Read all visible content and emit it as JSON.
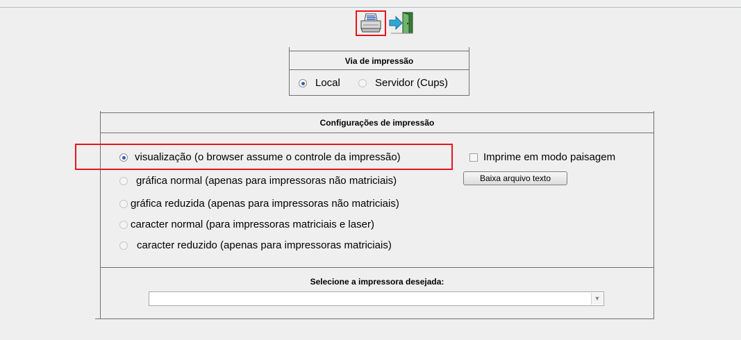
{
  "toolbar": {
    "print_icon": "printer-icon",
    "exit_icon": "exit-door-icon",
    "highlight_color": "#e8141b"
  },
  "via": {
    "title": "Via de impressão",
    "options": [
      {
        "label": "Local",
        "selected": true
      },
      {
        "label": "Servidor (Cups)",
        "selected": false
      }
    ]
  },
  "config": {
    "title": "Configurações de impressão",
    "options": [
      {
        "label": "visualização (o browser assume o controle da impressão)",
        "selected": true
      },
      {
        "label": "gráfica normal (apenas para impressoras não matriciais)",
        "selected": false
      },
      {
        "label": "gráfica reduzida (apenas para impressoras não matriciais)",
        "selected": false
      },
      {
        "label": "caracter normal (para impressoras matriciais e laser)",
        "selected": false
      },
      {
        "label": "caracter reduzido (apenas para impressoras matriciais)",
        "selected": false
      }
    ],
    "landscape_label": "Imprime em modo paisagem",
    "landscape_checked": false,
    "download_button": "Baixa arquivo texto"
  },
  "printer": {
    "title": "Selecione a impressora desejada:",
    "selected_value": ""
  }
}
